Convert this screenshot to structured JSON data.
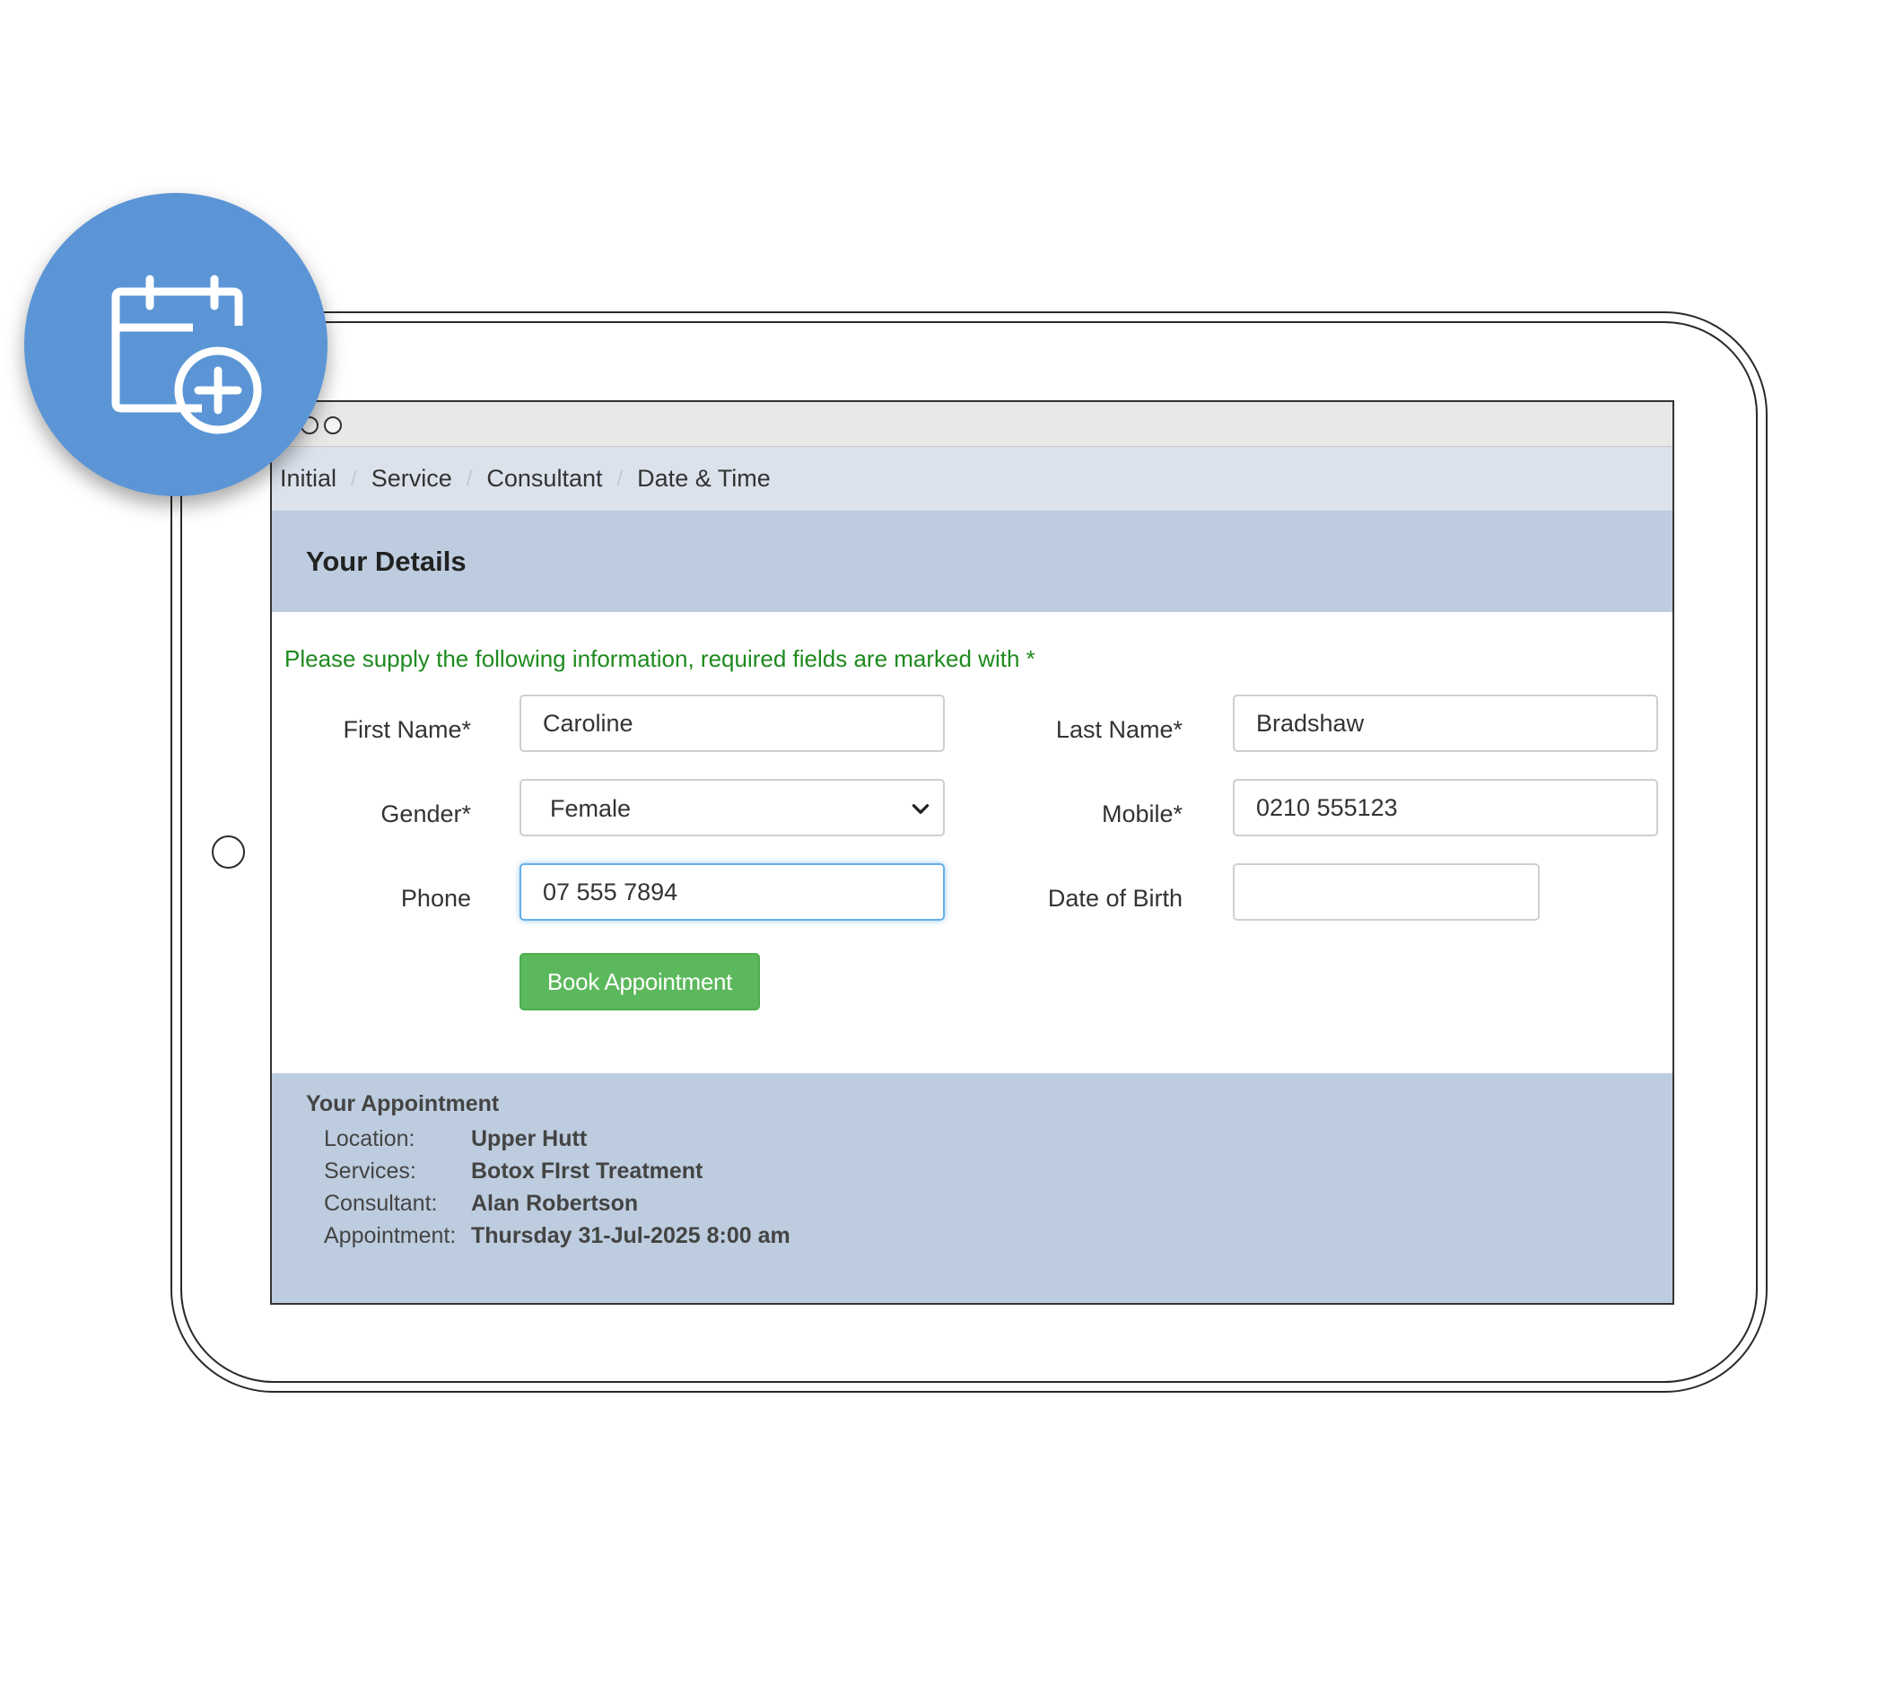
{
  "window": {
    "dots": [
      "close",
      "minimize",
      "maximize"
    ]
  },
  "breadcrumb": {
    "items": [
      {
        "label": "Initial"
      },
      {
        "label": "Service"
      },
      {
        "label": "Consultant"
      },
      {
        "label": "Date & Time"
      }
    ],
    "separator": "/"
  },
  "details": {
    "title": "Your Details",
    "instruction": "Please supply the following information, required fields are marked with *"
  },
  "form": {
    "first_name": {
      "label": "First Name*",
      "value": "Caroline"
    },
    "last_name": {
      "label": "Last Name*",
      "value": "Bradshaw"
    },
    "gender": {
      "label": "Gender*",
      "value": "Female"
    },
    "mobile": {
      "label": "Mobile*",
      "value": "0210 555123"
    },
    "phone": {
      "label": "Phone",
      "value": "07 555 7894"
    },
    "dob": {
      "label": "Date of Birth",
      "value": ""
    },
    "submit_label": "Book Appointment"
  },
  "appointment": {
    "title": "Your Appointment",
    "location": {
      "label": "Location:",
      "value": "Upper Hutt"
    },
    "services": {
      "label": "Services:",
      "value": "Botox FIrst Treatment"
    },
    "consultant": {
      "label": "Consultant:",
      "value": "Alan Robertson"
    },
    "time": {
      "label": "Appointment:",
      "value": "Thursday 31-Jul-2025 8:00 am"
    }
  },
  "badge": {
    "icon": "calendar-add-icon"
  },
  "colors": {
    "badge": "#5b95d6",
    "breadcrumb_bg": "#dbe2ec",
    "section_bg": "#bdcddf",
    "instruction_text": "#1e8a1e",
    "button": "#5cb85c",
    "focus_ring": "#66afe9"
  }
}
